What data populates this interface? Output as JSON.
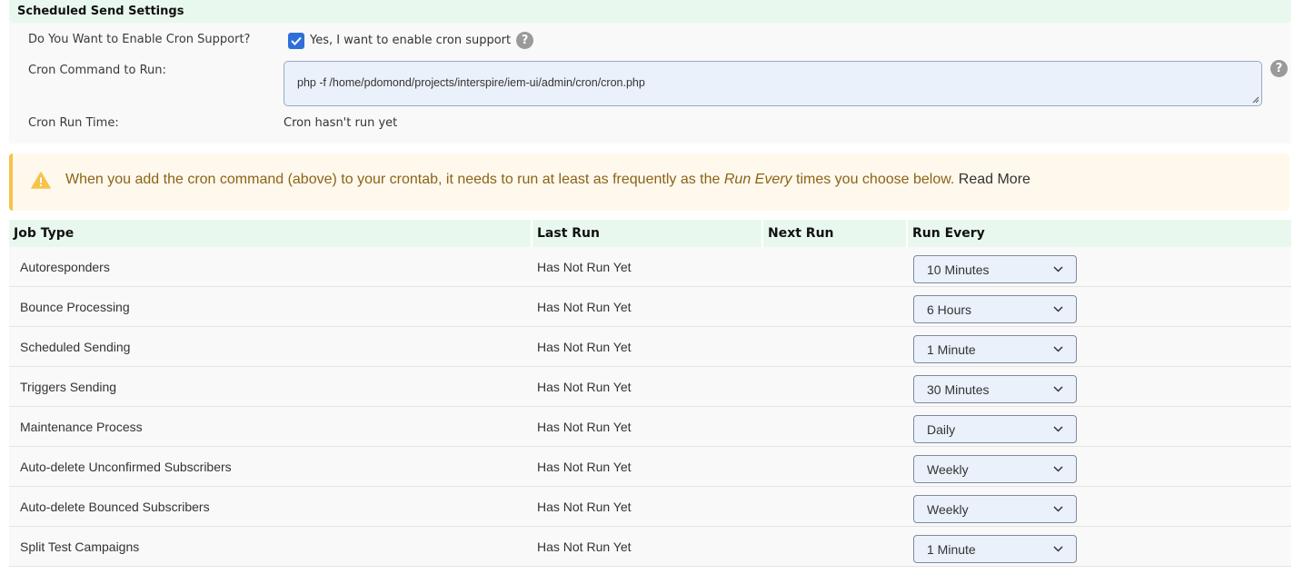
{
  "section": {
    "title": "Scheduled Send Settings"
  },
  "settings": {
    "enable_label": "Do You Want to Enable Cron Support?",
    "enable_checkbox_label": "Yes, I want to enable cron support",
    "enable_checked": true,
    "command_label": "Cron Command to Run:",
    "command_value": "php -f /home/pdomond/projects/interspire/iem-ui/admin/cron/cron.php",
    "run_time_label": "Cron Run Time:",
    "run_time_value": "Cron hasn't run yet",
    "help_glyph": "?"
  },
  "warning": {
    "text_before": "When you add the cron command (above) to your crontab, it needs to run at least as frequently as the ",
    "text_emphasis": "Run Every",
    "text_after": " times you choose below. ",
    "read_more": "Read More"
  },
  "table": {
    "headers": {
      "job_type": "Job Type",
      "last_run": "Last Run",
      "next_run": "Next Run",
      "run_every": "Run Every"
    },
    "rows": [
      {
        "job": "Autoresponders",
        "last_run": "Has Not Run Yet",
        "next_run": "",
        "run_every": "10 Minutes"
      },
      {
        "job": "Bounce Processing",
        "last_run": "Has Not Run Yet",
        "next_run": "",
        "run_every": "6 Hours"
      },
      {
        "job": "Scheduled Sending",
        "last_run": "Has Not Run Yet",
        "next_run": "",
        "run_every": "1 Minute"
      },
      {
        "job": "Triggers Sending",
        "last_run": "Has Not Run Yet",
        "next_run": "",
        "run_every": "30 Minutes"
      },
      {
        "job": "Maintenance Process",
        "last_run": "Has Not Run Yet",
        "next_run": "",
        "run_every": "Daily"
      },
      {
        "job": "Auto-delete Unconfirmed Subscribers",
        "last_run": "Has Not Run Yet",
        "next_run": "",
        "run_every": "Weekly"
      },
      {
        "job": "Auto-delete Bounced Subscribers",
        "last_run": "Has Not Run Yet",
        "next_run": "",
        "run_every": "Weekly"
      },
      {
        "job": "Split Test Campaigns",
        "last_run": "Has Not Run Yet",
        "next_run": "",
        "run_every": "1 Minute"
      }
    ]
  },
  "colors": {
    "header_bg": "#e9f8ee",
    "checkbox": "#2f6fd8",
    "warning_bg": "#fff8ec",
    "warning_accent": "#f7c34a",
    "warning_text": "#8a6418",
    "select_bg": "#eaf1fb"
  },
  "icons": {
    "checkbox": "checkmark-icon",
    "help": "question-circle-icon",
    "warning": "warning-triangle-icon",
    "select": "chevron-down-icon"
  }
}
